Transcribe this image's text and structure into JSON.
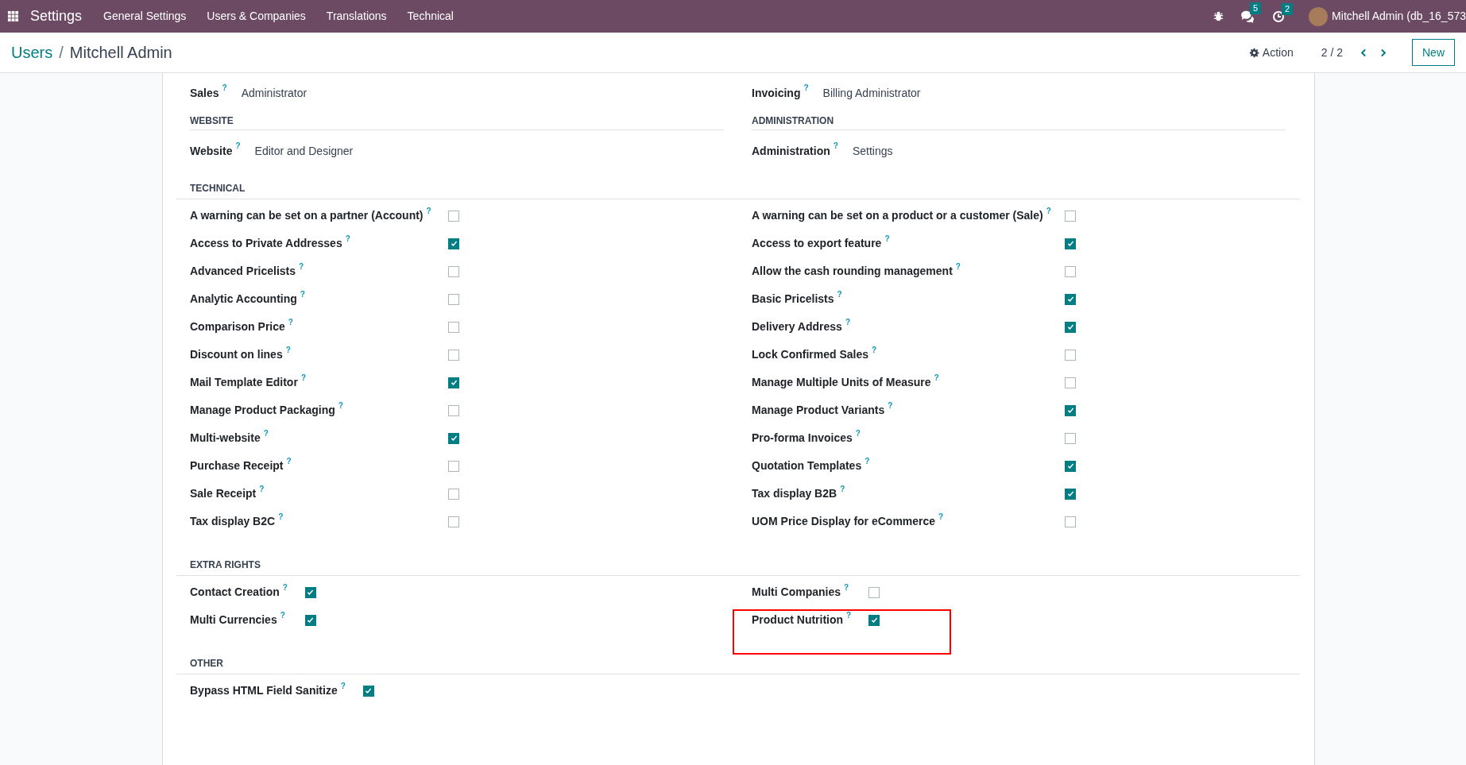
{
  "navbar": {
    "app": "Settings",
    "menus": [
      "General Settings",
      "Users & Companies",
      "Translations",
      "Technical"
    ],
    "messages_count": "5",
    "activities_count": "2",
    "user": "Mitchell Admin (db_16_573"
  },
  "control_panel": {
    "breadcrumb": "Users",
    "separator": "/",
    "title": "Mitchell Admin",
    "action": "Action",
    "pager": "2 / 2",
    "new_button": "New"
  },
  "top_fields": [
    {
      "label": "Sales",
      "help": "?",
      "value": "Administrator"
    },
    {
      "label": "Invoicing",
      "help": "?",
      "value": "Billing Administrator"
    }
  ],
  "groups": [
    {
      "heading": "WEBSITE",
      "label": "Website",
      "help": "?",
      "value": "Editor and Designer"
    },
    {
      "heading": "ADMINISTRATION",
      "label": "Administration",
      "help": "?",
      "value": "Settings"
    }
  ],
  "sections": [
    {
      "heading": "TECHNICAL",
      "kind": "wide",
      "columns": [
        [
          {
            "label": "A warning can be set on a partner (Account)",
            "help": "?",
            "checked": false
          },
          {
            "label": "Access to Private Addresses",
            "help": "?",
            "checked": true
          },
          {
            "label": "Advanced Pricelists",
            "help": "?",
            "checked": false
          },
          {
            "label": "Analytic Accounting",
            "help": "?",
            "checked": false
          },
          {
            "label": "Comparison Price",
            "help": "?",
            "checked": false
          },
          {
            "label": "Discount on lines",
            "help": "?",
            "checked": false
          },
          {
            "label": "Mail Template Editor",
            "help": "?",
            "checked": true
          },
          {
            "label": "Manage Product Packaging",
            "help": "?",
            "checked": false
          },
          {
            "label": "Multi-website",
            "help": "?",
            "checked": true
          },
          {
            "label": "Purchase Receipt",
            "help": "?",
            "checked": false
          },
          {
            "label": "Sale Receipt",
            "help": "?",
            "checked": false
          },
          {
            "label": "Tax display B2C",
            "help": "?",
            "checked": false
          }
        ],
        [
          {
            "label": "A warning can be set on a product or a customer (Sale)",
            "help": "?",
            "checked": false
          },
          {
            "label": "Access to export feature",
            "help": "?",
            "checked": true
          },
          {
            "label": "Allow the cash rounding management",
            "help": "?",
            "checked": false
          },
          {
            "label": "Basic Pricelists",
            "help": "?",
            "checked": true
          },
          {
            "label": "Delivery Address",
            "help": "?",
            "checked": true
          },
          {
            "label": "Lock Confirmed Sales",
            "help": "?",
            "checked": false
          },
          {
            "label": "Manage Multiple Units of Measure",
            "help": "?",
            "checked": false
          },
          {
            "label": "Manage Product Variants",
            "help": "?",
            "checked": true
          },
          {
            "label": "Pro-forma Invoices",
            "help": "?",
            "checked": false
          },
          {
            "label": "Quotation Templates",
            "help": "?",
            "checked": true
          },
          {
            "label": "Tax display B2B",
            "help": "?",
            "checked": true
          },
          {
            "label": "UOM Price Display for eCommerce",
            "help": "?",
            "checked": false
          }
        ]
      ]
    },
    {
      "heading": "EXTRA RIGHTS",
      "kind": "compact",
      "columns": [
        [
          {
            "label": "Contact Creation",
            "help": "?",
            "checked": true
          },
          {
            "label": "Multi Currencies",
            "help": "?",
            "checked": true
          }
        ],
        [
          {
            "label": "Multi Companies",
            "help": "?",
            "checked": false
          },
          {
            "label": "Product Nutrition",
            "help": "?",
            "checked": true,
            "highlighted": true
          }
        ]
      ]
    },
    {
      "heading": "OTHER",
      "kind": "compact",
      "columns": [
        [
          {
            "label": "Bypass HTML Field Sanitize",
            "help": "?",
            "checked": true
          }
        ]
      ]
    }
  ]
}
